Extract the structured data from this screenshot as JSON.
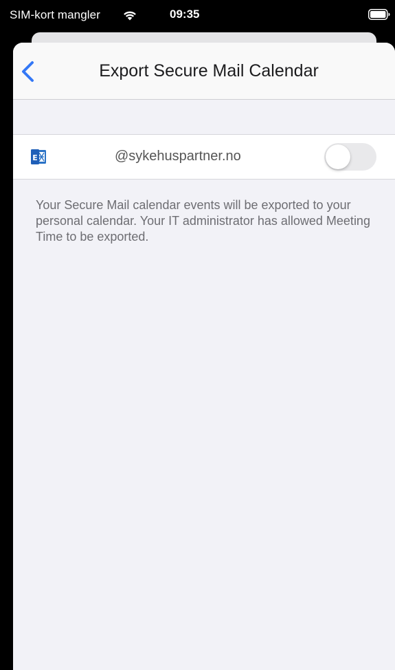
{
  "status_bar": {
    "carrier": "SIM-kort mangler",
    "time": "09:35",
    "wifi_icon": "wifi-icon",
    "battery_icon": "battery-icon"
  },
  "nav": {
    "title": "Export Secure Mail Calendar",
    "back_icon": "chevron-left-icon",
    "accent_color": "#3478f6"
  },
  "account": {
    "icon": "exchange-icon",
    "email": "@sykehuspartner.no",
    "export_enabled": false
  },
  "description": "Your Secure Mail calendar events will be exported to your personal calendar. Your IT administrator has allowed Meeting Time to be exported."
}
